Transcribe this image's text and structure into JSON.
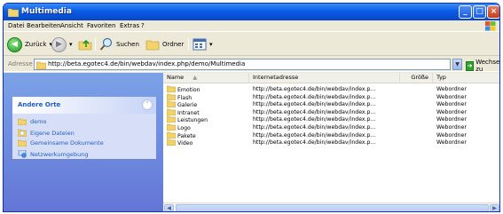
{
  "window": {
    "title": "Multimedia"
  },
  "menu": {
    "items": [
      "Datei",
      "Bearbeiten",
      "Ansicht",
      "Favoriten",
      "Extras",
      "?"
    ]
  },
  "toolbar": {
    "back_label": "Zurück",
    "search_label": "Suchen",
    "folders_label": "Ordner"
  },
  "address": {
    "label": "Adresse",
    "value": "http://beta.egotec4.de/bin/webdav/index.php/demo/Multimedia",
    "go_label": "Wechseln zu"
  },
  "tasks": {
    "panel_title": "Andere Orte",
    "links": [
      "demo",
      "Eigene Dateien",
      "Gemeinsame Dokumente",
      "Netzwerkumgebung"
    ]
  },
  "list": {
    "columns": [
      "Name",
      "Internetadresse",
      "Größe",
      "Typ"
    ],
    "rows": [
      {
        "name": "Emotion",
        "url": "http://beta.egotec4.de/bin/webdav/index.p...",
        "size": "",
        "type": "Webordner"
      },
      {
        "name": "Flash",
        "url": "http://beta.egotec4.de/bin/webdav/index.p...",
        "size": "",
        "type": "Webordner"
      },
      {
        "name": "Galerie",
        "url": "http://beta.egotec4.de/bin/webdav/index.p...",
        "size": "",
        "type": "Webordner"
      },
      {
        "name": "Intranet",
        "url": "http://beta.egotec4.de/bin/webdav/index.p...",
        "size": "",
        "type": "Webordner"
      },
      {
        "name": "Leistungen",
        "url": "http://beta.egotec4.de/bin/webdav/index.p...",
        "size": "",
        "type": "Webordner"
      },
      {
        "name": "Logo",
        "url": "http://beta.egotec4.de/bin/webdav/index.p...",
        "size": "",
        "type": "Webordner"
      },
      {
        "name": "Pakete",
        "url": "http://beta.egotec4.de/bin/webdav/index.p...",
        "size": "",
        "type": "Webordner"
      },
      {
        "name": "Video",
        "url": "http://beta.egotec4.de/bin/webdav/index.p...",
        "size": "",
        "type": "Webordner"
      }
    ]
  },
  "colors": {
    "titlebar": "#0a5ce7",
    "tasks_bg": "#7ba2e7",
    "link": "#215dc6",
    "folder": "#f3d26b"
  }
}
